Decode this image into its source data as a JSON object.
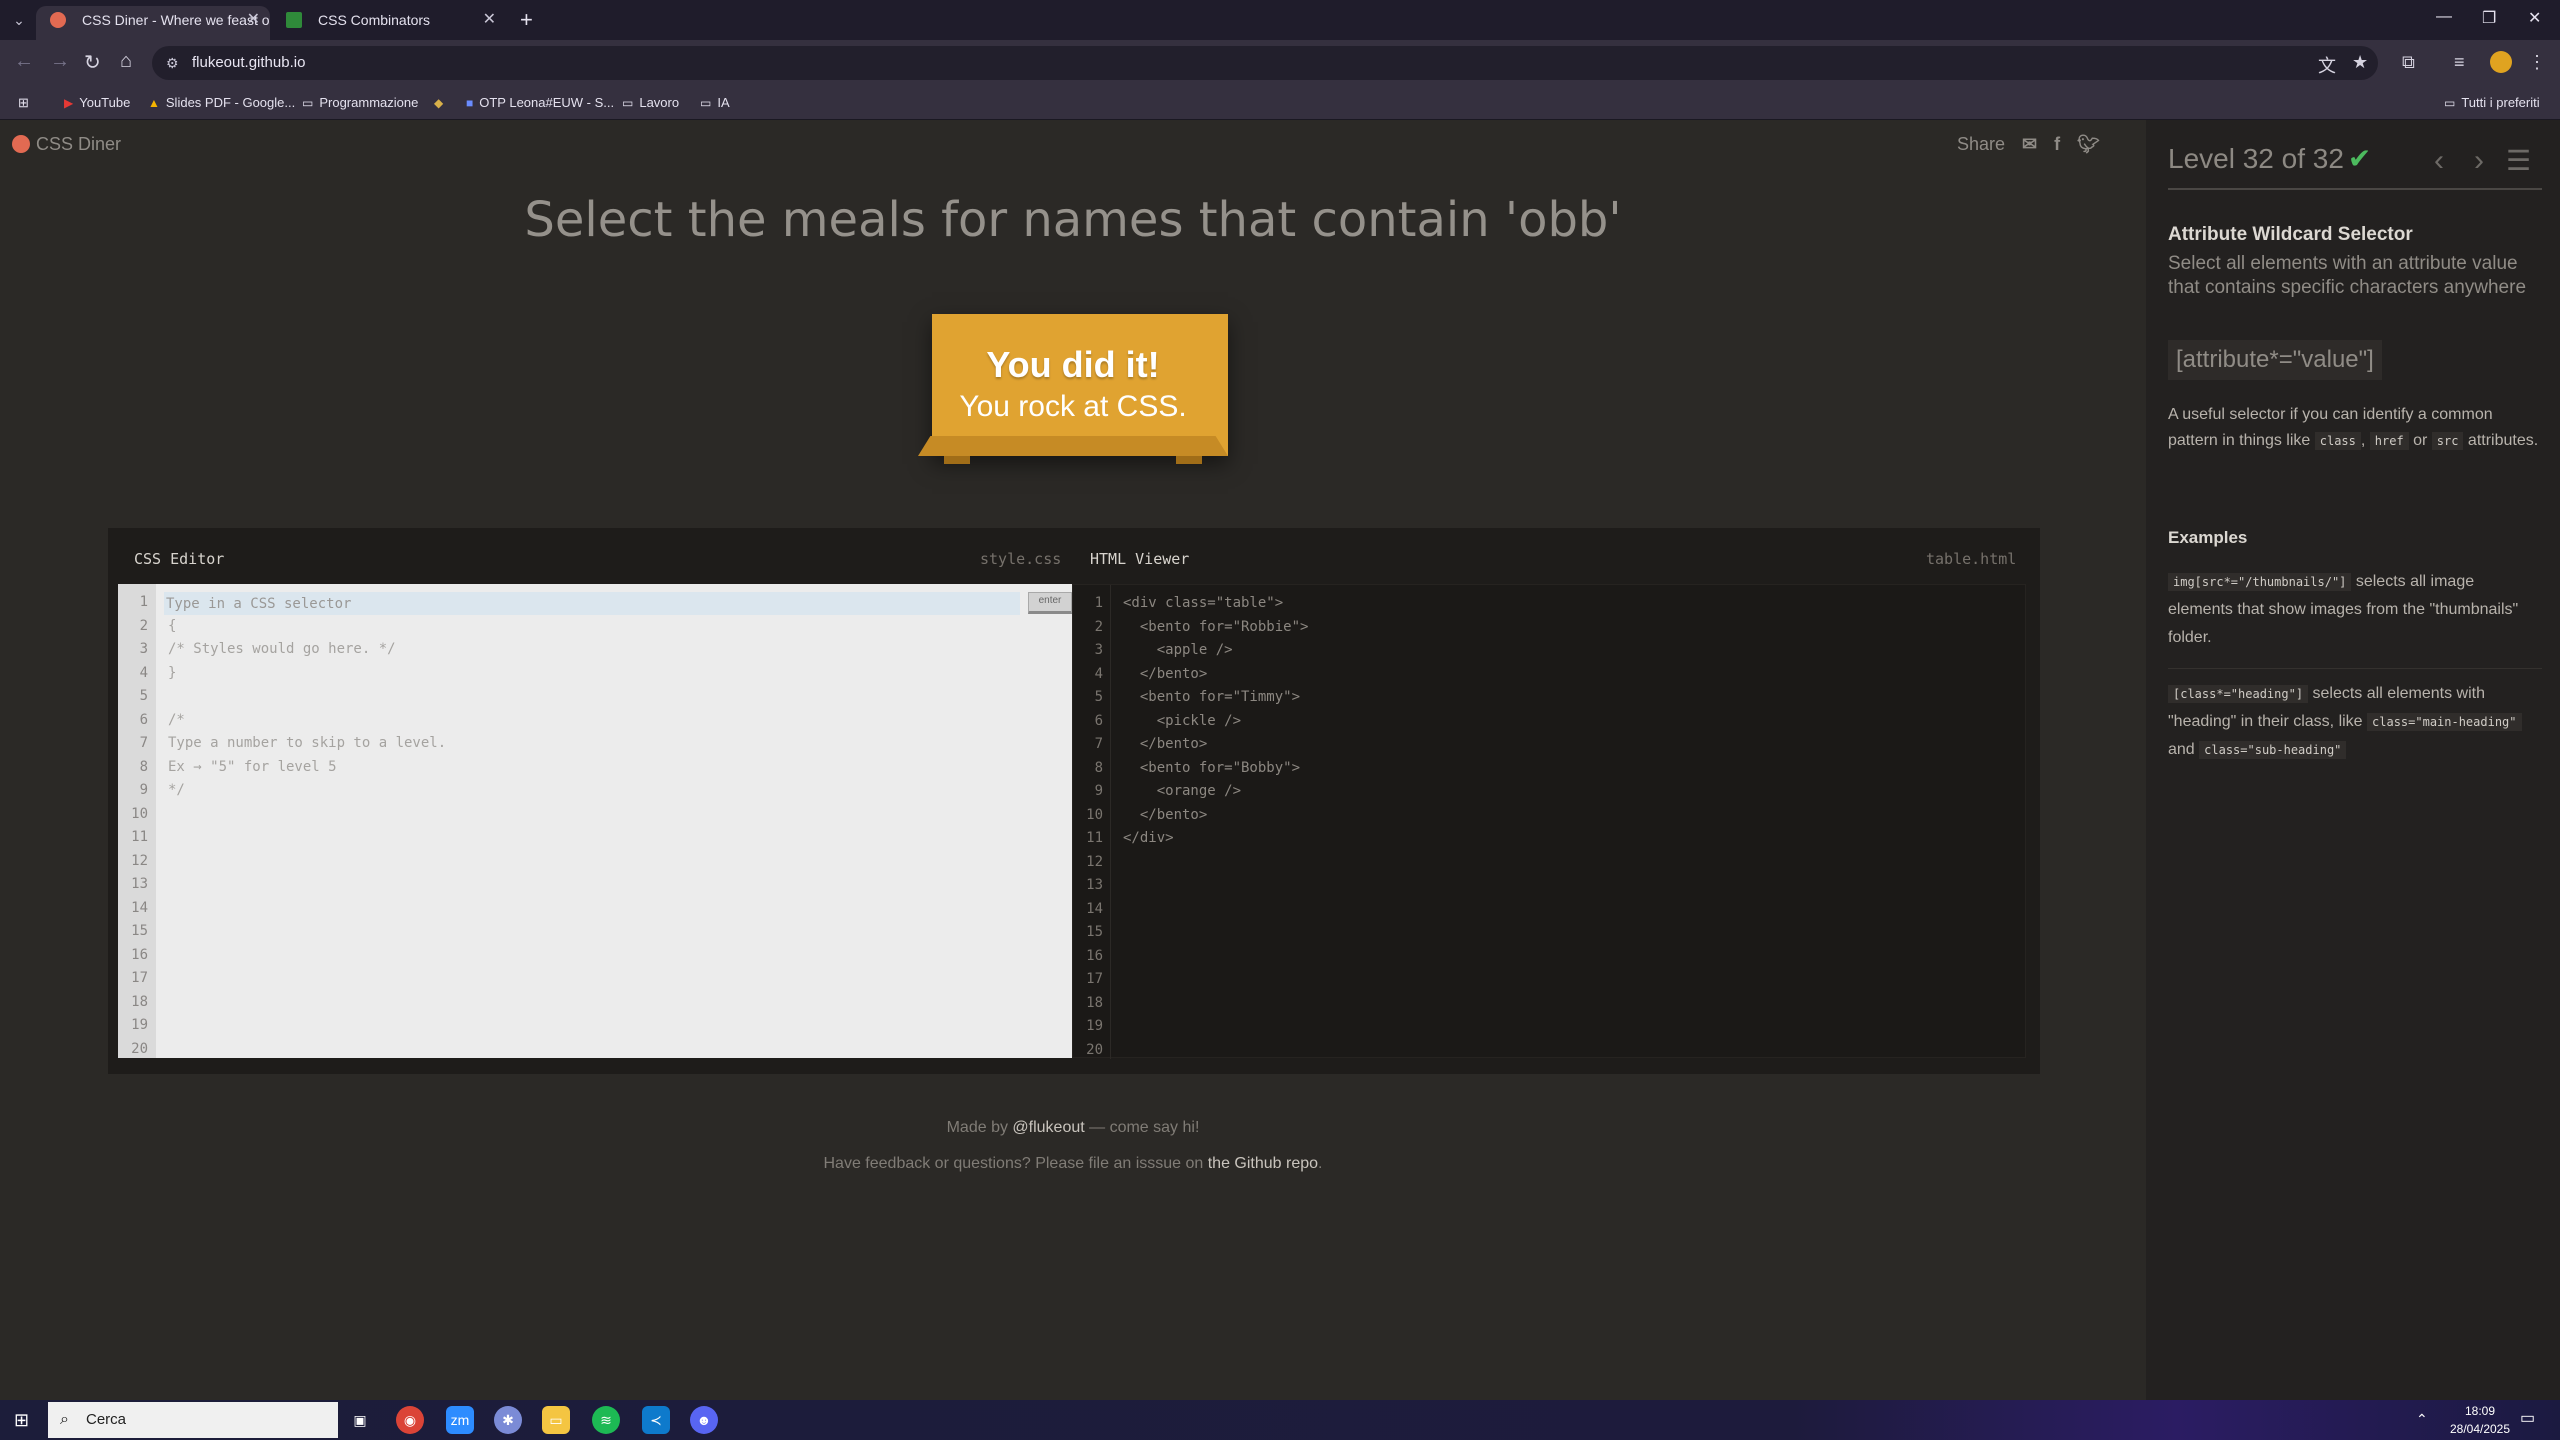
{
  "browser": {
    "tabs": [
      {
        "title": "CSS Diner - Where we feast on",
        "active": true
      },
      {
        "title": "CSS Combinators",
        "active": false
      }
    ],
    "url": "flukeout.github.io",
    "bookmarks": [
      "YouTube",
      "Slides PDF - Google...",
      "Programmazione",
      "OTP Leona#EUW - S...",
      "Lavoro",
      "IA"
    ],
    "all_bookmarks": "Tutti i preferiti"
  },
  "page": {
    "logo": "CSS Diner",
    "share": "Share",
    "headline": "Select the meals for names that contain 'obb'",
    "win_line1": "You did it!",
    "win_line2": "You rock at CSS.",
    "css_editor": {
      "title": "CSS Editor",
      "file": "style.css",
      "placeholder": "Type in a CSS selector",
      "enter": "enter",
      "lines": [
        "",
        "{",
        "/* Styles would go here. */",
        "}",
        "",
        "/*",
        "Type a number to skip to a level.",
        "Ex → \"5\" for level 5",
        "*/",
        "",
        "",
        "",
        "",
        "",
        "",
        "",
        "",
        "",
        "",
        ""
      ]
    },
    "html_viewer": {
      "title": "HTML Viewer",
      "file": "table.html",
      "lines": [
        "<div class=\"table\">",
        "  <bento for=\"Robbie\">",
        "    <apple />",
        "  </bento>",
        "  <bento for=\"Timmy\">",
        "    <pickle />",
        "  </bento>",
        "  <bento for=\"Bobby\">",
        "    <orange />",
        "  </bento>",
        "</div>",
        "",
        "",
        "",
        "",
        "",
        "",
        "",
        "",
        ""
      ]
    },
    "credits": {
      "made_by": "Made by ",
      "author": "@flukeout",
      "say_hi": " — come say hi!",
      "feedback": "Have feedback or questions? Please file an isssue on ",
      "repo": "the Github repo",
      "end": "."
    }
  },
  "sidebar": {
    "level": "Level 32 of 32",
    "title": "Attribute Wildcard Selector",
    "subtitle": "Select all elements with an attribute value that contains specific characters anywhere",
    "syntax": "[attribute*=\"value\"]",
    "hint_pre": "A useful selector if you can identify a common pattern in things like ",
    "hint_class": "class",
    "hint_href": "href",
    "hint_or": " or ",
    "hint_src": "src",
    "hint_post": " attributes.",
    "examples_title": "Examples",
    "ex1_code": "img[src*=\"/thumbnails/\"]",
    "ex1_text": " selects all image elements that show images from the \"thumbnails\" folder.",
    "ex2_code": "[class*=\"heading\"]",
    "ex2_text": " selects all elements with \"heading\" in their class, like ",
    "ex2_code2": "class=\"main-heading\"",
    "ex2_and": " and ",
    "ex2_code3": "class=\"sub-heading\""
  },
  "taskbar": {
    "search": "Cerca",
    "time": "18:09",
    "date": "28/04/2025"
  }
}
